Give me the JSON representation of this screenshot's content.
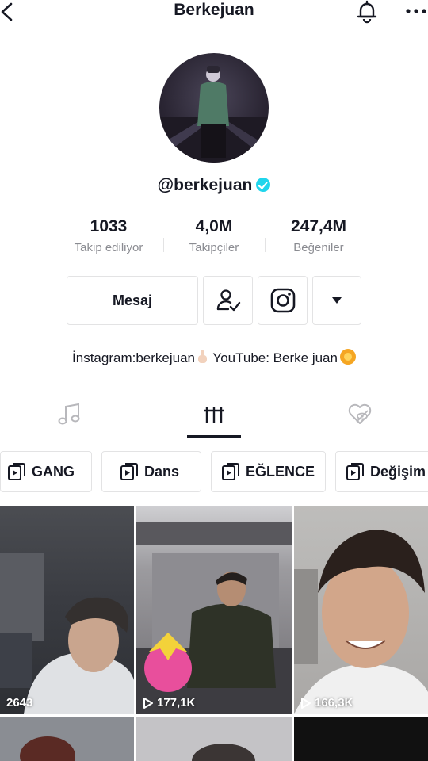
{
  "header": {
    "title": "Berkejuan",
    "back_icon": "chevron-left-icon",
    "bell_icon": "bell-icon",
    "more_icon": "more-horizontal-icon"
  },
  "profile": {
    "handle": "@berkejuan",
    "verified": true
  },
  "stats": [
    {
      "value": "1033",
      "label": "Takip ediliyor"
    },
    {
      "value": "4,0M",
      "label": "Takipçiler"
    },
    {
      "value": "247,4M",
      "label": "Beğeniler"
    }
  ],
  "actions": {
    "message": "Mesaj",
    "following_icon": "user-check-icon",
    "instagram_icon": "instagram-icon",
    "dropdown_icon": "triangle-down-icon"
  },
  "bio": {
    "text_a": "İnstagram:berkejuan",
    "text_b": " YouTube: Berke juan"
  },
  "tabs": [
    {
      "icon": "music-note-icon",
      "active": false
    },
    {
      "icon": "videos-grid-icon",
      "active": true
    },
    {
      "icon": "liked-hidden-icon",
      "active": false
    }
  ],
  "playlists": [
    "GANG",
    "Dans",
    "EĞLENCE",
    "Değişim"
  ],
  "videos": [
    {
      "views": "2643",
      "show_play": false
    },
    {
      "views": "177,1K",
      "show_play": true
    },
    {
      "views": "166,3K",
      "show_play": true
    }
  ],
  "colors": {
    "text": "#161823",
    "muted": "#8a8b91",
    "border": "#e3e3e4",
    "verified": "#20d5ec"
  }
}
